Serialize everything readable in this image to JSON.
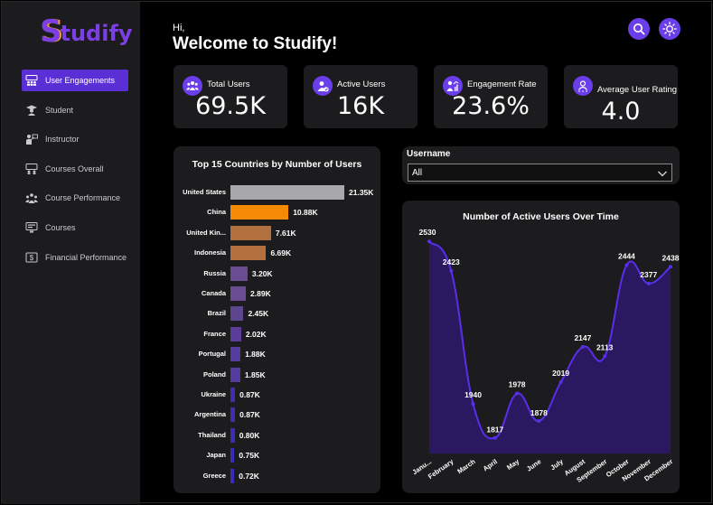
{
  "app": {
    "logo_initial": "S",
    "logo_rest": "tudify"
  },
  "colors": {
    "accent": "#6a3ee8",
    "active_nav": "#5b2fd6",
    "panel": "#1c1c1e",
    "bar_highlight": "#f58a07",
    "bar_secondary": "#b2703f",
    "bar_grey": "#a8a8aa"
  },
  "sidebar": {
    "items": [
      {
        "label": "User Engagements",
        "icon": "users-board-icon",
        "active": true
      },
      {
        "label": "Student",
        "icon": "student-icon",
        "active": false
      },
      {
        "label": "Instructor",
        "icon": "instructor-icon",
        "active": false
      },
      {
        "label": "Courses Overall",
        "icon": "courses-overall-icon",
        "active": false
      },
      {
        "label": "Course Performance",
        "icon": "course-performance-icon",
        "active": false
      },
      {
        "label": "Courses",
        "icon": "courses-icon",
        "active": false
      },
      {
        "label": "Financial Performance",
        "icon": "financial-icon",
        "active": false
      }
    ]
  },
  "header": {
    "greeting": "Hi,",
    "title": "Welcome to Studify!"
  },
  "toolbar": {
    "search_icon": "search-icon",
    "theme_icon": "sun-icon"
  },
  "kpis": [
    {
      "label": "Total Users",
      "value": "69.5K",
      "icon": "users-group-icon"
    },
    {
      "label": "Active Users",
      "value": "16K",
      "icon": "active-user-icon"
    },
    {
      "label": "Engagement Rate",
      "value": "23.6%",
      "icon": "engagement-icon"
    },
    {
      "label": "Average User Rating",
      "value": "4.0",
      "icon": "user-rating-icon"
    }
  ],
  "filter": {
    "label": "Username",
    "value": "All"
  },
  "chart_data": [
    {
      "type": "bar",
      "orientation": "horizontal",
      "title": "Top 15 Countries by Number of Users",
      "categories": [
        "United States",
        "China",
        "United Kin...",
        "Indonesia",
        "Russia",
        "Canada",
        "Brazil",
        "France",
        "Portugal",
        "Poland",
        "Ukraine",
        "Argentina",
        "Thailand",
        "Japan",
        "Greece"
      ],
      "values": [
        21350,
        10880,
        7610,
        6690,
        3200,
        2890,
        2450,
        2020,
        1880,
        1850,
        870,
        870,
        800,
        750,
        720
      ],
      "data_labels": [
        "21.35K",
        "10.88K",
        "7.61K",
        "6.69K",
        "3.20K",
        "2.89K",
        "2.45K",
        "2.02K",
        "1.88K",
        "1.85K",
        "0.87K",
        "0.87K",
        "0.80K",
        "0.75K",
        "0.72K"
      ],
      "bar_colors": [
        "#a8a8aa",
        "#f58a07",
        "#b2703f",
        "#b2703f",
        "#6a4c93",
        "#6a4c93",
        "#5d4590",
        "#5a3d9a",
        "#553ba0",
        "#553ba0",
        "#3f2fb0",
        "#3f2fb0",
        "#3d2cb5",
        "#3b2ab8",
        "#3b2ab8"
      ],
      "grid": false,
      "legend": "none"
    },
    {
      "type": "area",
      "title": "Number of Active Users Over Time",
      "categories": [
        "Janu...",
        "February",
        "March",
        "April",
        "May",
        "June",
        "July",
        "August",
        "September",
        "October",
        "November",
        "December"
      ],
      "values": [
        2530,
        2423,
        1940,
        1817,
        1978,
        1878,
        2019,
        2147,
        2113,
        2444,
        2377,
        2438
      ],
      "data_labels": [
        "2530",
        "2423",
        "1940",
        "1817",
        "1978",
        "1878",
        "2019",
        "2147",
        "2113",
        "2444",
        "2377",
        "2438"
      ],
      "ylim": [
        1760,
        2580
      ],
      "line_color": "#5a2ee8",
      "fill_color": "#2a1860",
      "grid": false,
      "legend": "none"
    }
  ]
}
